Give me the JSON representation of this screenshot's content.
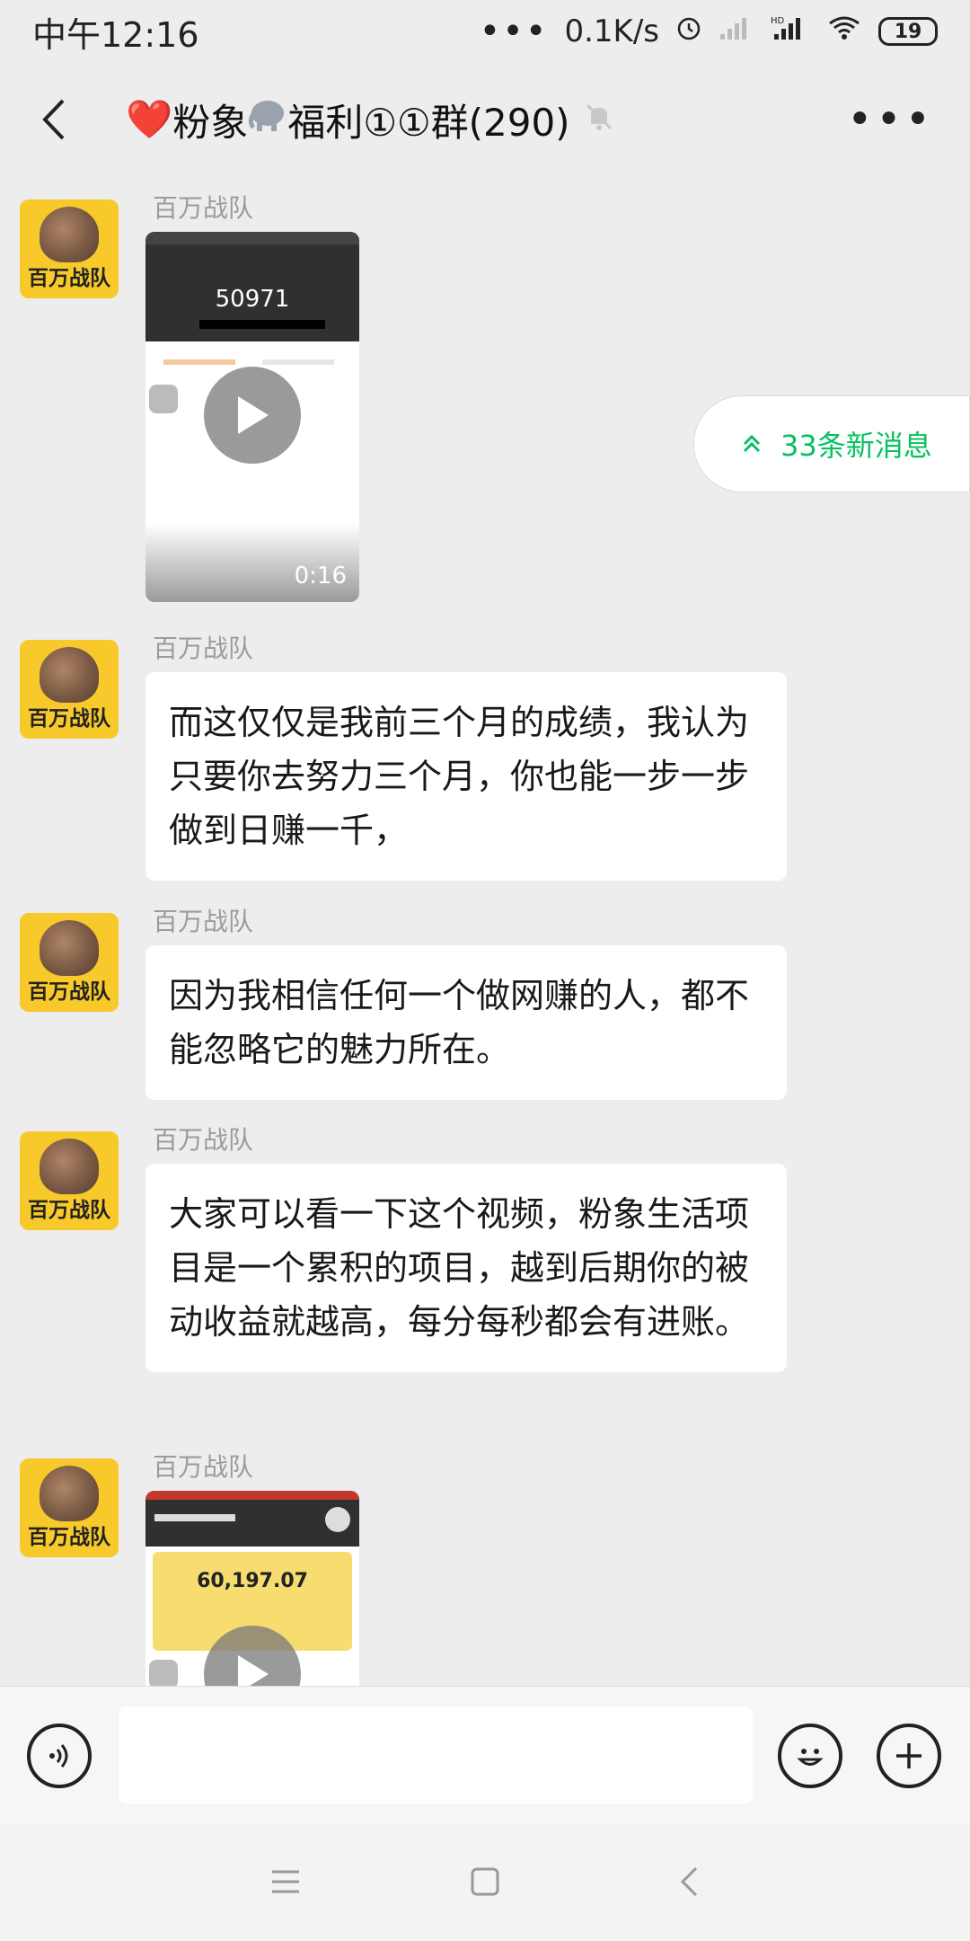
{
  "status_bar": {
    "time": "中午12:16",
    "dots": "•••",
    "net_speed": "0.1K/s",
    "battery": "19"
  },
  "header": {
    "title_prefix": "❤️",
    "title_part1": "粉象",
    "title_part2": "福利①①群(290)",
    "more": "•••"
  },
  "new_messages_pill": "33条新消息",
  "messages": [
    {
      "sender": "百万战队",
      "type": "video",
      "preview_number": "50971",
      "duration": "0:16"
    },
    {
      "sender": "百万战队",
      "type": "text",
      "text": "而这仅仅是我前三个月的成绩，我认为只要你去努力三个月，你也能一步一步做到日赚一千，"
    },
    {
      "sender": "百万战队",
      "type": "text",
      "text": "因为我相信任何一个做网赚的人，都不能忽略它的魅力所在。"
    },
    {
      "sender": "百万战队",
      "type": "text",
      "text": "大家可以看一下这个视频，粉象生活项目是一个累积的项目，越到后期你的被动收益就越高，每分每秒都会有进账。"
    },
    {
      "sender": "百万战队",
      "type": "video",
      "preview_number": "60,197.07"
    }
  ],
  "avatar_text": "百万战队",
  "colors": {
    "accent_green": "#07c160",
    "avatar_yellow": "#f7c92a",
    "bubble_bg": "#ffffff",
    "chat_bg": "#ededed"
  },
  "icons": [
    "back-arrow-icon",
    "elephant-emoji-icon",
    "mute-bell-icon",
    "more-icon",
    "double-chevron-up-icon",
    "voice-icon",
    "emoji-icon",
    "plus-icon",
    "play-icon",
    "menu-icon",
    "home-square-icon",
    "back-nav-icon"
  ]
}
